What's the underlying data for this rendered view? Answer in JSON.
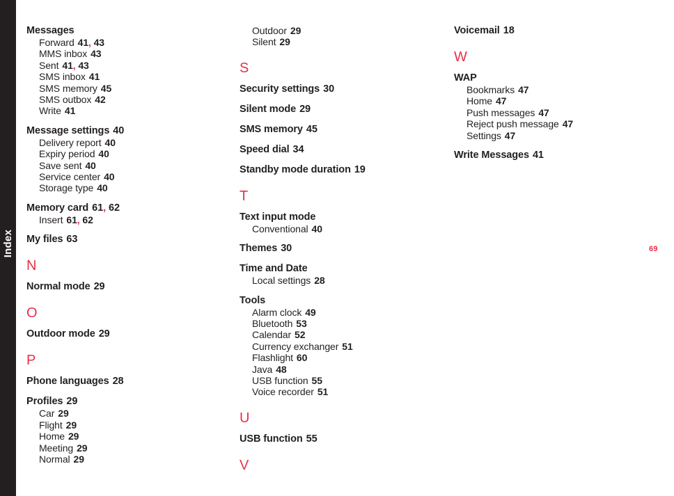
{
  "side_tab": {
    "label": "Index"
  },
  "folio": {
    "page_number": "69"
  },
  "columns": [
    {
      "id": "column-left",
      "blocks": [
        {
          "type": "entry",
          "title": "Messages",
          "pages": "",
          "subs": [
            {
              "label": "Forward",
              "pages": "41, 43"
            },
            {
              "label": "MMS inbox",
              "pages": "43"
            },
            {
              "label": "Sent",
              "pages": "41, 43"
            },
            {
              "label": "SMS inbox",
              "pages": "41"
            },
            {
              "label": "SMS memory",
              "pages": "45"
            },
            {
              "label": "SMS outbox",
              "pages": "42"
            },
            {
              "label": "Write",
              "pages": "41"
            }
          ]
        },
        {
          "type": "entry",
          "title": "Message settings",
          "pages": "40",
          "subs": [
            {
              "label": "Delivery report",
              "pages": "40"
            },
            {
              "label": "Expiry period",
              "pages": "40"
            },
            {
              "label": "Save sent",
              "pages": "40"
            },
            {
              "label": "Service center",
              "pages": "40"
            },
            {
              "label": "Storage type",
              "pages": "40"
            }
          ]
        },
        {
          "type": "entry",
          "title": "Memory card",
          "pages": "61, 62",
          "subs": [
            {
              "label": "Insert",
              "pages": "61, 62"
            }
          ]
        },
        {
          "type": "entry",
          "title": "My files",
          "pages": "63",
          "subs": []
        },
        {
          "type": "letter",
          "letter": "N"
        },
        {
          "type": "entry",
          "title": "Normal mode",
          "pages": "29",
          "subs": []
        },
        {
          "type": "letter",
          "letter": "O"
        },
        {
          "type": "entry",
          "title": "Outdoor mode",
          "pages": "29",
          "subs": []
        },
        {
          "type": "letter",
          "letter": "P"
        },
        {
          "type": "entry",
          "title": "Phone languages",
          "pages": "28",
          "subs": []
        },
        {
          "type": "entry",
          "title": "Profiles",
          "pages": "29",
          "subs": [
            {
              "label": "Car",
              "pages": "29"
            },
            {
              "label": "Flight",
              "pages": "29"
            },
            {
              "label": "Home",
              "pages": "29"
            },
            {
              "label": "Meeting",
              "pages": "29"
            },
            {
              "label": "Normal",
              "pages": "29"
            }
          ]
        }
      ]
    },
    {
      "id": "column-middle",
      "blocks": [
        {
          "type": "entry",
          "title": "",
          "pages": "",
          "subs": [
            {
              "label": "Outdoor",
              "pages": "29"
            },
            {
              "label": "Silent",
              "pages": "29"
            }
          ]
        },
        {
          "type": "letter",
          "letter": "S"
        },
        {
          "type": "entry",
          "title": "Security settings",
          "pages": "30",
          "subs": []
        },
        {
          "type": "entry",
          "title": "Silent mode",
          "pages": "29",
          "subs": []
        },
        {
          "type": "entry",
          "title": "SMS memory",
          "pages": "45",
          "subs": []
        },
        {
          "type": "entry",
          "title": "Speed dial",
          "pages": "34",
          "subs": []
        },
        {
          "type": "entry",
          "title": "Standby mode duration",
          "pages": "19",
          "subs": []
        },
        {
          "type": "letter",
          "letter": "T"
        },
        {
          "type": "entry",
          "title": "Text input mode",
          "pages": "",
          "subs": [
            {
              "label": "Conventional",
              "pages": "40"
            }
          ]
        },
        {
          "type": "entry",
          "title": "Themes",
          "pages": "30",
          "subs": []
        },
        {
          "type": "entry",
          "title": "Time and Date",
          "pages": "",
          "subs": [
            {
              "label": "Local settings",
              "pages": "28"
            }
          ]
        },
        {
          "type": "entry",
          "title": "Tools",
          "pages": "",
          "subs": [
            {
              "label": "Alarm clock",
              "pages": "49"
            },
            {
              "label": "Bluetooth",
              "pages": "53"
            },
            {
              "label": "Calendar",
              "pages": "52"
            },
            {
              "label": "Currency exchanger",
              "pages": "51"
            },
            {
              "label": "Flashlight",
              "pages": "60"
            },
            {
              "label": "Java",
              "pages": "48"
            },
            {
              "label": "USB function",
              "pages": "55"
            },
            {
              "label": "Voice recorder",
              "pages": "51"
            }
          ]
        },
        {
          "type": "letter",
          "letter": "U"
        },
        {
          "type": "entry",
          "title": "USB function",
          "pages": "55",
          "subs": []
        },
        {
          "type": "letter",
          "letter": "V"
        }
      ]
    },
    {
      "id": "column-right",
      "blocks": [
        {
          "type": "entry",
          "title": "Voicemail",
          "pages": "18",
          "subs": []
        },
        {
          "type": "letter",
          "letter": "W"
        },
        {
          "type": "entry",
          "title": "WAP",
          "pages": "",
          "subs": [
            {
              "label": "Bookmarks",
              "pages": "47"
            },
            {
              "label": "Home",
              "pages": "47"
            },
            {
              "label": "Push messages",
              "pages": "47"
            },
            {
              "label": "Reject push message",
              "pages": "47"
            },
            {
              "label": "Settings",
              "pages": "47"
            }
          ]
        },
        {
          "type": "entry",
          "title": "Write Messages",
          "pages": "41",
          "subs": []
        }
      ]
    }
  ],
  "colors": {
    "accent_red": "#e8304a",
    "text_black": "#231f20",
    "tab_background": "#231f20",
    "page_background": "#ffffff"
  }
}
